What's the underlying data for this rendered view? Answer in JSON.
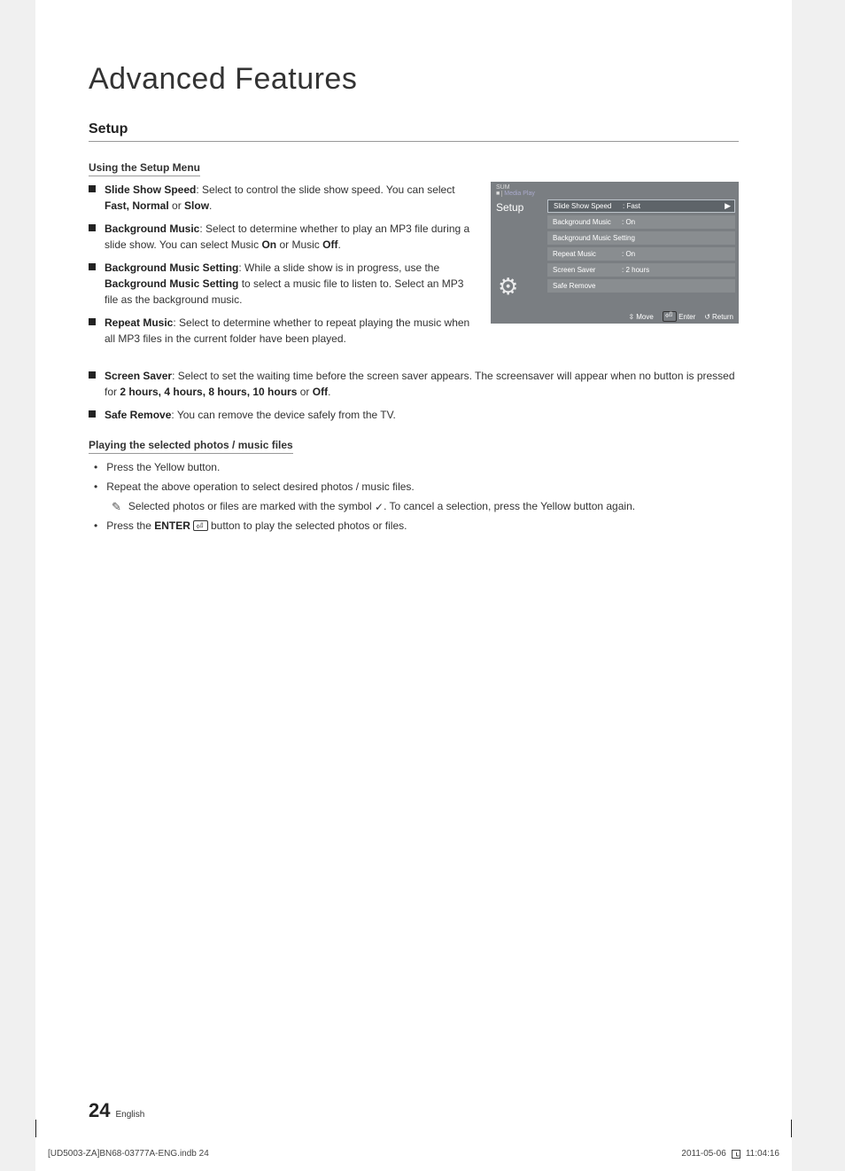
{
  "page": {
    "title": "Advanced Features",
    "section": "Setup",
    "sub1": "Using the Setup Menu",
    "sub2": "Playing the selected photos / music files",
    "number": "24",
    "language": "English"
  },
  "bullets": {
    "slideShowSpeed": {
      "label": "Slide Show Speed",
      "text": ": Select to control the slide show speed. You can select ",
      "opt1": "Fast, Normal",
      "opt_or": " or ",
      "opt2": "Slow",
      "period": "."
    },
    "bgMusic": {
      "label": "Background Music",
      "text": ": Select to determine whether to play an MP3 file during a slide show. You can select Music ",
      "on": "On",
      "mid": " or Music ",
      "off": "Off",
      "period": "."
    },
    "bgMusicSetting": {
      "label": "Background Music Setting",
      "text1": ": While a slide show is in progress, use the ",
      "bold2": "Background Music Setting",
      "text2": " to select a music file to listen to. Select an MP3 file as the background music."
    },
    "repeatMusic": {
      "label": "Repeat Music",
      "text": ": Select to determine whether to repeat playing the music when all MP3 files in the current folder have been played."
    },
    "screenSaver": {
      "label": "Screen Saver",
      "text1": ": Select to set the waiting time before the screen saver appears. The screensaver will appear when no button is pressed for ",
      "bold2": "2 hours, 4 hours, 8 hours, 10 hours",
      "text2": " or ",
      "bold3": "Off",
      "period": "."
    },
    "safeRemove": {
      "label": "Safe Remove",
      "text": ": You can remove the device safely from the TV."
    }
  },
  "playing": {
    "l1": "Press the Yellow button.",
    "l2": "Repeat the above operation to select desired photos / music files.",
    "note_pre": "Selected photos or files are marked with the symbol ",
    "note_post": ". To cancel a selection, press the Yellow button again.",
    "l3_pre": "Press the ",
    "l3_bold": "ENTER",
    "l3_post": " button to play the selected photos or files."
  },
  "osd": {
    "header_line1": "SUM",
    "header_line2": "Media Play",
    "side": "Setup",
    "rows": [
      {
        "label": "Slide Show Speed",
        "val": ": Fast",
        "selected": true
      },
      {
        "label": "Background Music",
        "val": ": On",
        "selected": false
      },
      {
        "label": "Background Music Setting",
        "val": "",
        "selected": false
      },
      {
        "label": "Repeat Music",
        "val": ": On",
        "selected": false
      },
      {
        "label": "Screen Saver",
        "val": ": 2 hours",
        "selected": false
      },
      {
        "label": "Safe Remove",
        "val": "",
        "selected": false
      }
    ],
    "footer": {
      "move": "Move",
      "enter": "Enter",
      "return": "Return"
    }
  },
  "print": {
    "file": "[UD5003-ZA]BN68-03777A-ENG.indb   24",
    "date": "2011-05-06",
    "time": "11:04:16"
  }
}
